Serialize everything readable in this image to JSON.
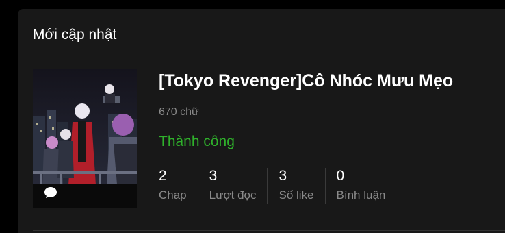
{
  "section": {
    "title": "Mới cập nhật"
  },
  "story": {
    "title": "[Tokyo Revenger]Cô Nhóc Mưu Mẹo",
    "word_count": "670 chữ",
    "status": "Thành công",
    "cover_icon": "comment-bubble-icon",
    "stats": [
      {
        "value": "2",
        "label": "Chap"
      },
      {
        "value": "3",
        "label": "Lượt đọc"
      },
      {
        "value": "3",
        "label": "Số like"
      },
      {
        "value": "0",
        "label": "Bình luận"
      }
    ]
  },
  "colors": {
    "background": "#181818",
    "status_green": "#2fb12b",
    "muted_text": "#8a8a8a"
  }
}
